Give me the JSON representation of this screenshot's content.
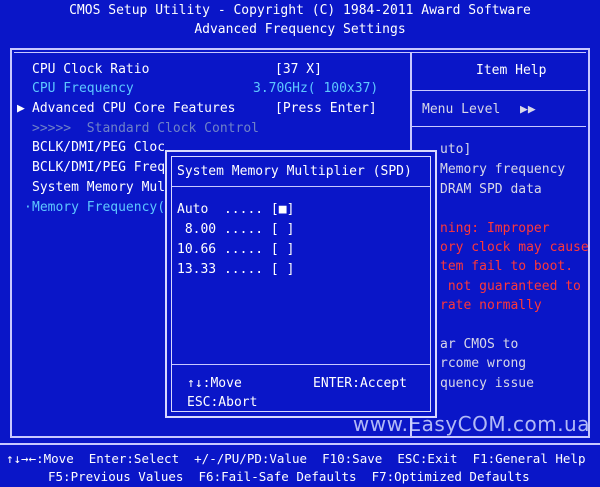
{
  "header": {
    "title": "CMOS Setup Utility - Copyright (C) 1984-2011 Award Software",
    "subtitle": "Advanced Frequency Settings"
  },
  "menu": {
    "items": [
      {
        "label": "CPU Clock Ratio",
        "value": "[37 X]"
      },
      {
        "label": "CPU Frequency",
        "value": "3.70GHz( 100x37)"
      },
      {
        "label": "Advanced CPU Core Features",
        "value": "[Press Enter]",
        "marker": "▶"
      },
      {
        "label": ">>>>>  Standard Clock Control"
      },
      {
        "label": "BCLK/DMI/PEG Cloc"
      },
      {
        "label": "BCLK/DMI/PEG Freq"
      },
      {
        "label": "System Memory Mul"
      },
      {
        "label": "Memory Frequency(",
        "marker": "·"
      }
    ]
  },
  "help": {
    "title": "Item Help",
    "menu_level": "Menu Level",
    "menu_level_arrows": "▶▶",
    "lines_normal": [
      "uto]",
      "Memory frequency",
      "DRAM SPD data"
    ],
    "lines_warning": [
      "ning: Improper",
      "ory clock may cause",
      "tem fail to boot.",
      " not guaranteed to",
      "rate normally"
    ],
    "lines_tail": [
      "ar CMOS to",
      "rcome wrong",
      "quency issue"
    ]
  },
  "popup": {
    "title": "System Memory Multiplier (SPD)",
    "options": [
      {
        "text": "Auto  ..... [■]"
      },
      {
        "text": " 8.00 ..... [ ]"
      },
      {
        "text": "10.66 ..... [ ]"
      },
      {
        "text": "13.33 ..... [ ]"
      }
    ],
    "hint_move": "↑↓:Move",
    "hint_accept": "ENTER:Accept",
    "hint_abort": "ESC:Abort"
  },
  "watermark": "www.EasyCOM.com.ua",
  "footer": {
    "line1": "↑↓→←:Move  Enter:Select  +/-/PU/PD:Value  F10:Save  ESC:Exit  F1:General Help",
    "line2": "F5:Previous Values  F6:Fail-Safe Defaults  F7:Optimized Defaults"
  },
  "colors": {
    "background": "#0a16c8",
    "highlight": "#5ec8ff",
    "warning": "#ff3838"
  }
}
